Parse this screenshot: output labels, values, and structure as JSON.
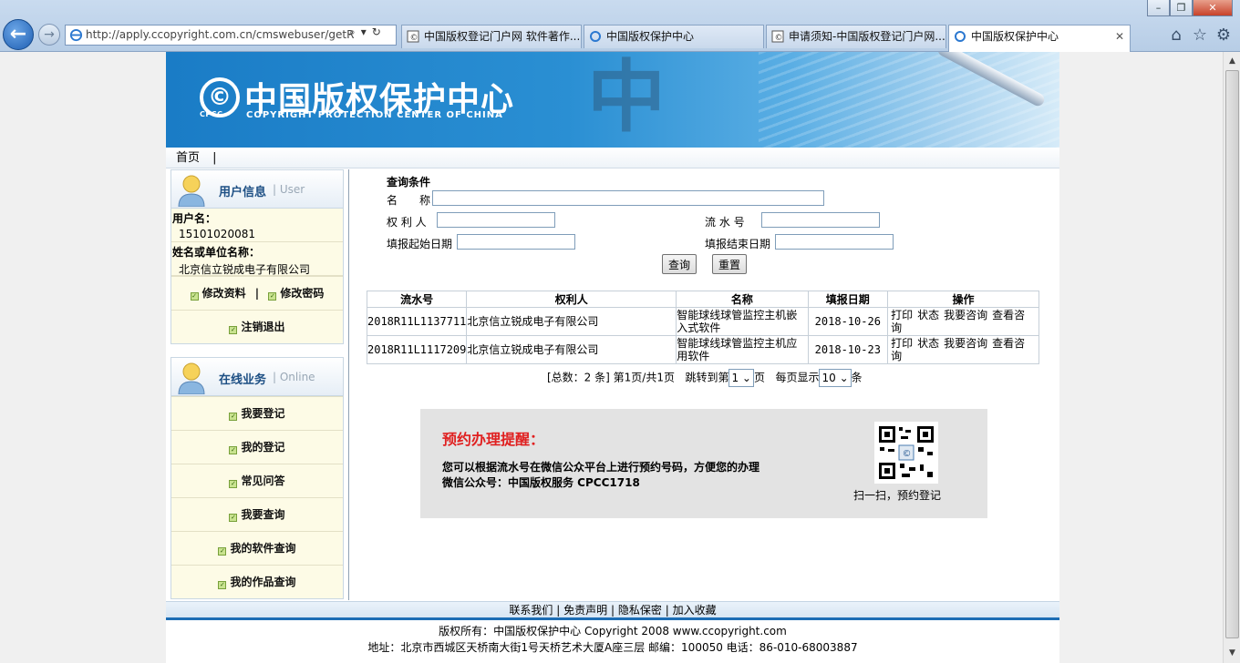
{
  "browser": {
    "address": "http://apply.ccopyright.com.cn/cmswebuser/getR",
    "tabs": [
      {
        "title": "中国版权登记门户网 软件著作..."
      },
      {
        "title": "中国版权保护中心"
      },
      {
        "title": "申请须知-中国版权登记门户网..."
      },
      {
        "title": "中国版权保护中心"
      }
    ]
  },
  "banner": {
    "title_cn": "中国版权保护中心",
    "title_en": "COPYRIGHT PROTECTION CENTER OF CHINA",
    "logo_sub": "CPCC",
    "logo_symbol": "©",
    "big_char": "中"
  },
  "nav": {
    "home": "首页",
    "sep": "|"
  },
  "user_box": {
    "title_cn": "用户信息",
    "title_en": "| User",
    "username_label": "用户名：",
    "username": "15101020081",
    "org_label": "姓名或单位名称：",
    "org": "北京信立锐成电子有限公司",
    "edit_profile": "修改资料",
    "row_sep": "|",
    "change_password": "修改密码",
    "logout": "注销退出"
  },
  "online_box": {
    "title_cn": "在线业务",
    "title_en": "| Online",
    "items": [
      "我要登记",
      "我的登记",
      "常见问答",
      "我要查询",
      "我的软件查询",
      "我的作品查询"
    ]
  },
  "query": {
    "title": "查询条件",
    "name_label": "名　　称",
    "owner_label": "权 利 人",
    "serial_label": "流 水 号",
    "start_label": "填报起始日期",
    "end_label": "填报结束日期",
    "search_btn": "查询",
    "reset_btn": "重置"
  },
  "table": {
    "headers": [
      "流水号",
      "权利人",
      "名称",
      "填报日期",
      "操作"
    ],
    "rows": [
      {
        "serial": "2018R11L1137711",
        "owner": "北京信立锐成电子有限公司",
        "name": "智能球线球管监控主机嵌入式软件",
        "date": "2018-10-26"
      },
      {
        "serial": "2018R11L1117209",
        "owner": "北京信立锐成电子有限公司",
        "name": "智能球线球管监控主机应用软件",
        "date": "2018-10-23"
      }
    ],
    "ops": [
      "打印",
      "状态",
      "我要咨询",
      "查看咨询"
    ]
  },
  "pager": {
    "total": "[总数：2 条]",
    "page_info": "第1页/共1页",
    "jump_prefix": "跳转到第",
    "jump_value": "1",
    "jump_suffix": "页",
    "per_page_prefix": "每页显示",
    "per_page_value": "10",
    "per_page_suffix": "条"
  },
  "reminder": {
    "title": "预约办理提醒：",
    "line1": "您可以根据流水号在微信公众平台上进行预约号码，方便您的办理",
    "line2": "微信公众号：中国版权服务 CPCC1718",
    "qr_caption": "扫一扫，预约登记"
  },
  "footer": {
    "links": [
      "联系我们",
      "免责声明",
      "隐私保密",
      "加入收藏"
    ],
    "link_sep": "|",
    "copyright": "版权所有：中国版权保护中心 Copyright 2008 www.ccopyright.com",
    "address": "地址：北京市西城区天桥南大街1号天桥艺术大厦A座三层 邮编：100050 电话：86-010-68003887"
  },
  "colors": {
    "brand_blue": "#1a7cc6",
    "reminder_red": "#e02020",
    "sidebar_bg": "#fdfbe6"
  }
}
